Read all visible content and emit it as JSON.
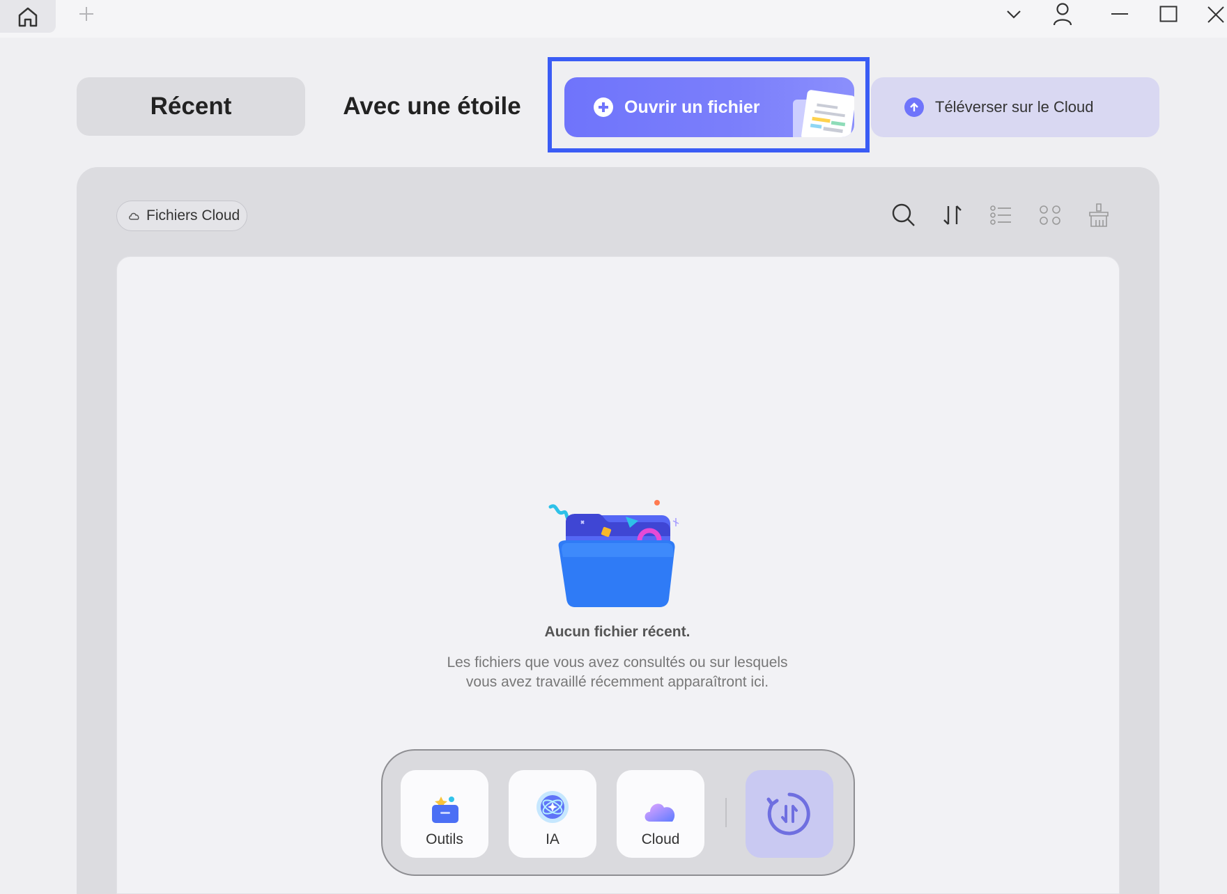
{
  "tabs": {
    "recent": "Récent",
    "starred": "Avec une étoile"
  },
  "actions": {
    "open_file": "Ouvrir un fichier",
    "upload_cloud": "Téléverser sur le Cloud"
  },
  "filter": {
    "cloud_files": "Fichiers Cloud"
  },
  "toolbar_icons": [
    "search-icon",
    "sort-icon",
    "list-view-icon",
    "grid-view-icon",
    "clear-icon"
  ],
  "empty_state": {
    "title": "Aucun fichier récent.",
    "description": "Les fichiers que vous avez consultés ou sur lesquels vous avez travaillé récemment apparaîtront ici."
  },
  "dock": {
    "tools": "Outils",
    "ai": "IA",
    "cloud": "Cloud"
  },
  "colors": {
    "accent": "#6f74fb",
    "highlight_border": "#3a5cf5",
    "upload_bg": "#d9d8f2"
  }
}
